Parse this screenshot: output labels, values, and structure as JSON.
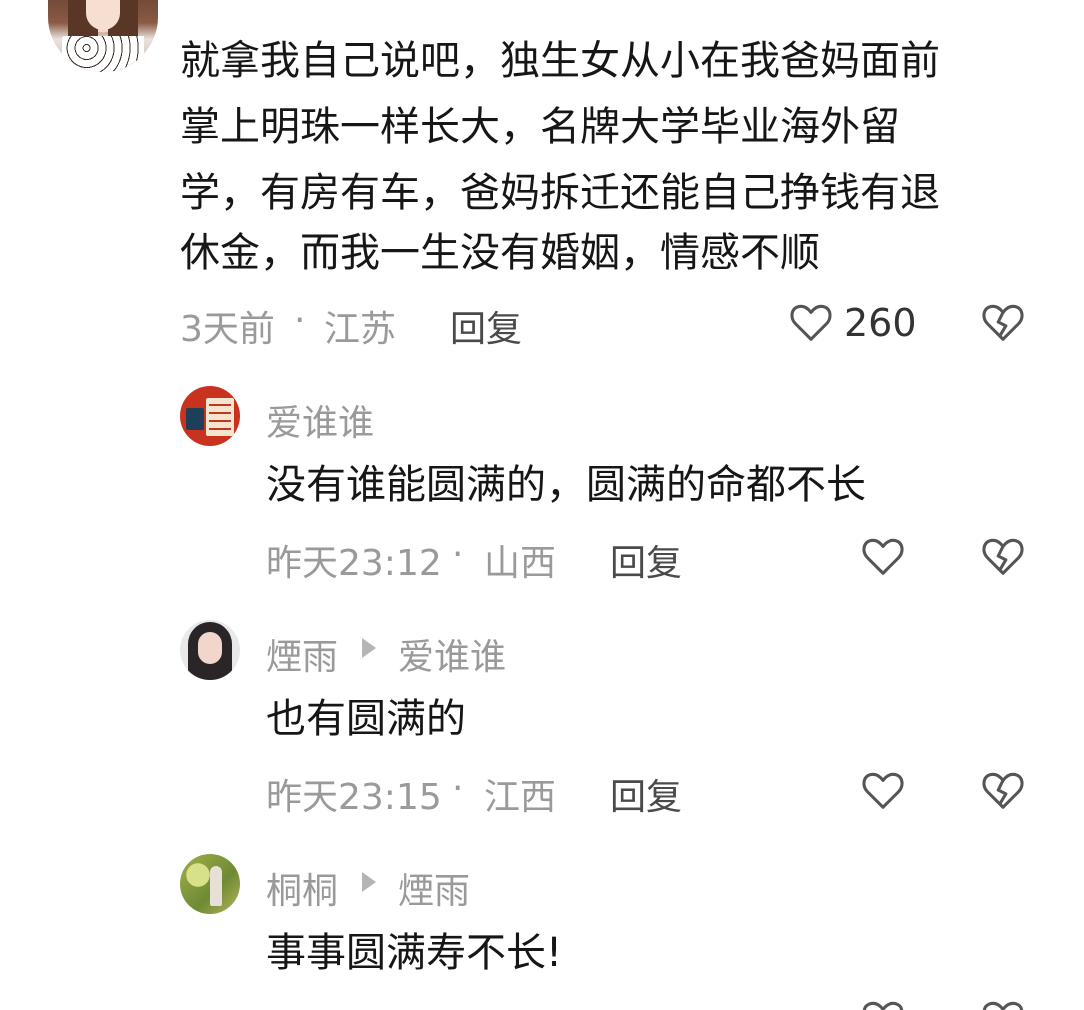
{
  "comments": [
    {
      "text_lines": [
        "就拿我自己说吧，独生女从小在我爸妈面前",
        "掌上明珠一样长大，名牌大学毕业海外留",
        "学，有房有车，爸妈拆迁还能自己挣钱有退",
        "休金，而我一生没有婚姻，情感不顺"
      ],
      "time": "3天前",
      "sep": "·",
      "location": "江苏",
      "reply_label": "回复",
      "like_count": "260"
    },
    {
      "username": "爱谁谁",
      "text": "没有谁能圆满的，圆满的命都不长",
      "time": "昨天23:12",
      "sep": "·",
      "location": "山西",
      "reply_label": "回复"
    },
    {
      "username": "煙雨",
      "reply_to": "爱谁谁",
      "text": "也有圆满的",
      "time": "昨天23:15",
      "sep": "·",
      "location": "江西",
      "reply_label": "回复"
    },
    {
      "username": "桐桐",
      "reply_to": "煙雨",
      "text": "事事圆满寿不长!"
    }
  ],
  "icons": {
    "like": "heart-outline-icon",
    "dislike": "broken-heart-icon"
  },
  "colors": {
    "text": "#161616",
    "meta": "#9a9a9a",
    "icon": "#555555"
  }
}
